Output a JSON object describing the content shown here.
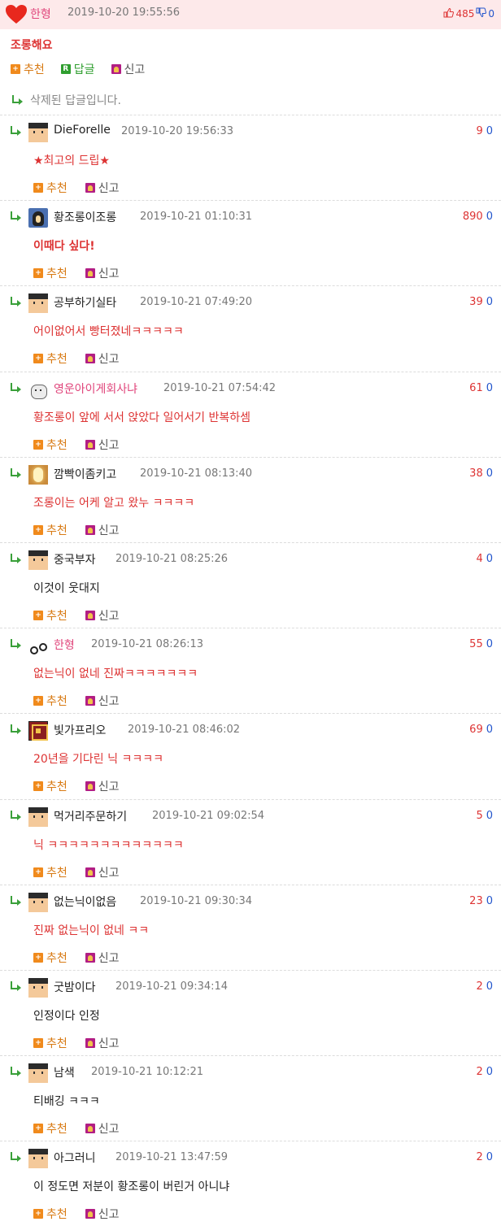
{
  "colors": {
    "accent_red": "#dd3333",
    "pink": "#e0457b",
    "reply_green": "#3aa03a",
    "down_blue": "#2255cc",
    "header_bg": "#fde9ea"
  },
  "main": {
    "author": "한형",
    "date": "2019-10-20 19:55:56",
    "up_count": "485",
    "down_count": "0",
    "body": "조롱해요",
    "actions": {
      "recommend": "추천",
      "reply": "답글",
      "report": "신고"
    }
  },
  "deleted_reply": "삭제된 답글입니다.",
  "comments": [
    {
      "nick": "DieForelle",
      "date": "2019-10-20 19:56:33",
      "up": "9",
      "down": "0",
      "text": "★최고의 드립★",
      "avatar": "default-avatar"
    },
    {
      "nick": "황조롱이조롱",
      "date": "2019-10-21 01:10:31",
      "up": "890",
      "down": "0",
      "text": "이때다 싶다!",
      "avatar": "penguin-avatar"
    },
    {
      "nick": "공부하기실타",
      "date": "2019-10-21 07:49:20",
      "up": "39",
      "down": "0",
      "text": "어이없어서 빵터졌네ㅋㅋㅋㅋㅋ",
      "avatar": "default-avatar"
    },
    {
      "nick": "영운아이게회사냐",
      "date": "2019-10-21 07:54:42",
      "up": "61",
      "down": "0",
      "text": "황조롱이 앞에 서서 앉았다 일어서기 반복하셈",
      "avatar": "cat-avatar"
    },
    {
      "nick": "깜빡이좀키고",
      "date": "2019-10-21 08:13:40",
      "up": "38",
      "down": "0",
      "text": "조롱이는 어케 알고 왔누 ㅋㅋㅋㅋ",
      "avatar": "light-avatar"
    },
    {
      "nick": "중국부자",
      "date": "2019-10-21 08:25:26",
      "up": "4",
      "down": "0",
      "text": "이것이 웃대지",
      "avatar": "default-avatar"
    },
    {
      "nick": "한형",
      "date": "2019-10-21 08:26:13",
      "up": "55",
      "down": "0",
      "text": "없는닉이 없네 진짜ㅋㅋㅋㅋㅋㅋㅋ",
      "avatar": "dots-avatar"
    },
    {
      "nick": "빛가프리오",
      "date": "2019-10-21 08:46:02",
      "up": "69",
      "down": "0",
      "text": "20년을 기다린 닉 ㅋㅋㅋㅋ",
      "avatar": "badge-avatar"
    },
    {
      "nick": "먹거리주문하기",
      "date": "2019-10-21 09:02:54",
      "up": "5",
      "down": "0",
      "text": "닉 ㅋㅋㅋㅋㅋㅋㅋㅋㅋㅋㅋㅋㅋ",
      "avatar": "default-avatar"
    },
    {
      "nick": "없는닉이없음",
      "date": "2019-10-21 09:30:34",
      "up": "23",
      "down": "0",
      "text": "진짜 없는닉이 없네 ㅋㅋ",
      "avatar": "default-avatar"
    },
    {
      "nick": "굿밤이다",
      "date": "2019-10-21 09:34:14",
      "up": "2",
      "down": "0",
      "text": "인정이다 인정",
      "avatar": "default-avatar"
    },
    {
      "nick": "남색",
      "date": "2019-10-21 10:12:21",
      "up": "2",
      "down": "0",
      "text": "티배깅 ㅋㅋㅋ",
      "avatar": "default-avatar"
    },
    {
      "nick": "아그러니",
      "date": "2019-10-21 13:47:59",
      "up": "2",
      "down": "0",
      "text": "이 정도면 저분이 황조롱이 버린거 아니냐",
      "avatar": "default-avatar"
    }
  ],
  "comment_actions": {
    "recommend": "추천",
    "report": "신고"
  }
}
